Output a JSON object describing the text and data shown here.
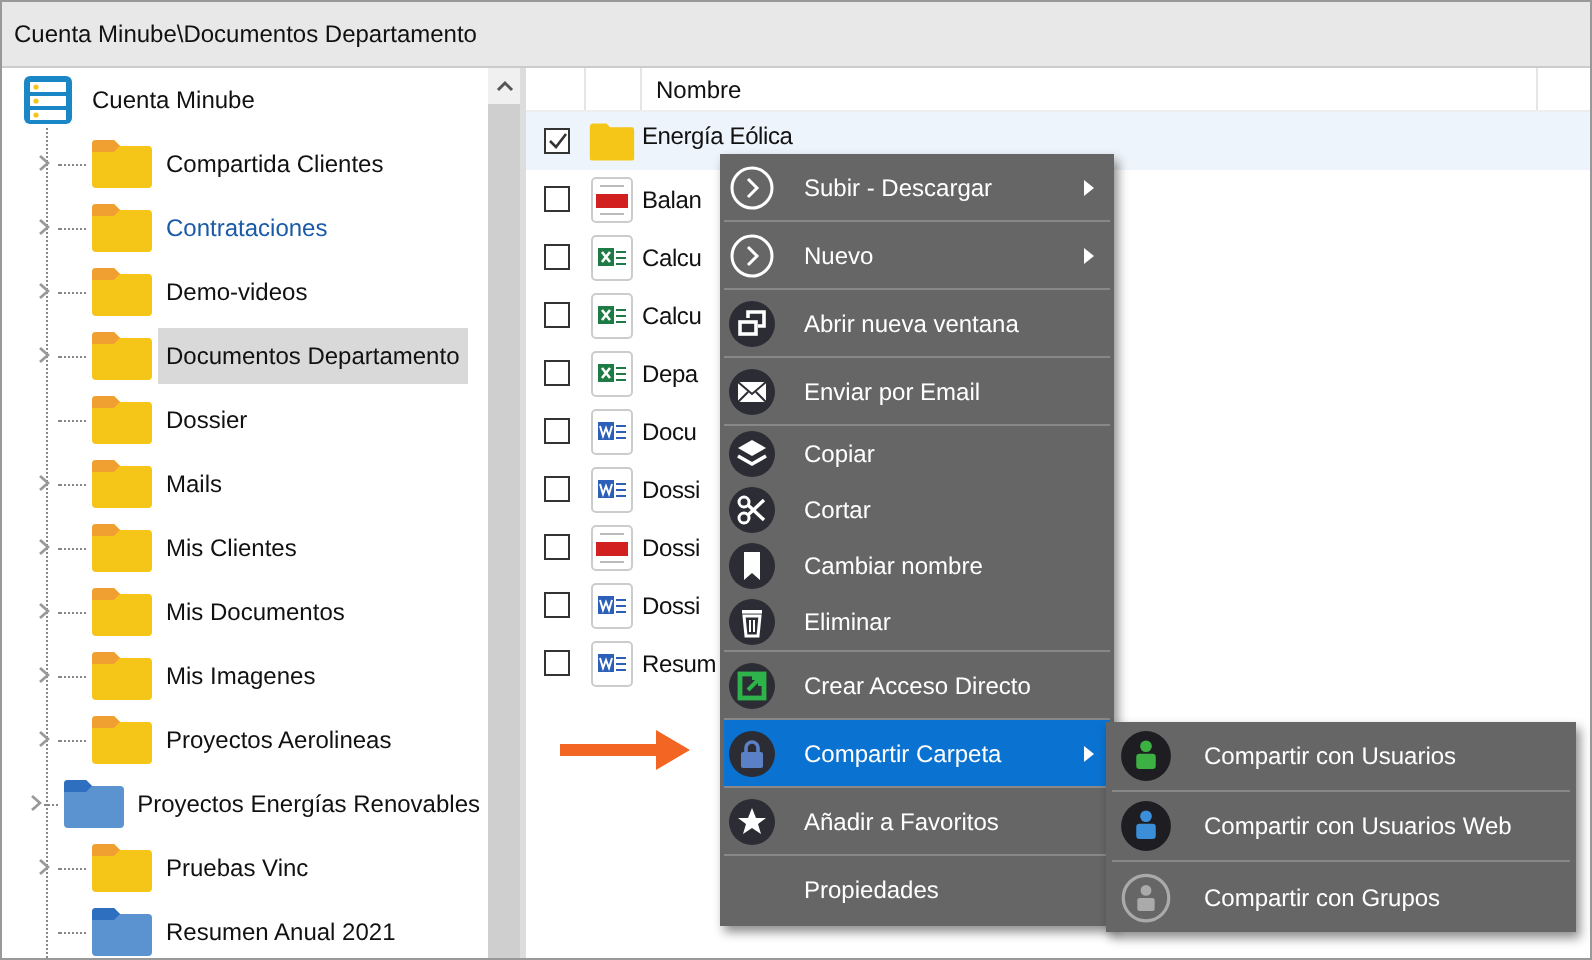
{
  "window": {
    "title": "Cuenta Minube\\Documentos Departamento"
  },
  "tree": {
    "root": {
      "label": "Cuenta Minube"
    },
    "children": [
      {
        "label": "Compartida Clientes",
        "color": "#f5c518",
        "expandable": true,
        "selected": false,
        "hovered": false
      },
      {
        "label": "Contrataciones",
        "color": "#f5c518",
        "expandable": true,
        "selected": false,
        "hovered": true
      },
      {
        "label": "Demo-videos",
        "color": "#f5c518",
        "expandable": true,
        "selected": false,
        "hovered": false
      },
      {
        "label": "Documentos Departamento",
        "color": "#f5c518",
        "expandable": true,
        "selected": true,
        "hovered": false
      },
      {
        "label": "Dossier",
        "color": "#f5c518",
        "expandable": false,
        "selected": false,
        "hovered": false
      },
      {
        "label": "Mails",
        "color": "#f5c518",
        "expandable": true,
        "selected": false,
        "hovered": false
      },
      {
        "label": "Mis Clientes",
        "color": "#f5c518",
        "expandable": true,
        "selected": false,
        "hovered": false
      },
      {
        "label": "Mis Documentos",
        "color": "#f5c518",
        "expandable": true,
        "selected": false,
        "hovered": false
      },
      {
        "label": "Mis Imagenes",
        "color": "#f5c518",
        "expandable": true,
        "selected": false,
        "hovered": false
      },
      {
        "label": "Proyectos Aerolineas",
        "color": "#f5c518",
        "expandable": true,
        "selected": false,
        "hovered": false
      },
      {
        "label": "Proyectos Energías Renovables",
        "color": "#5b92d0",
        "expandable": true,
        "selected": false,
        "hovered": false
      },
      {
        "label": "Pruebas Vinc",
        "color": "#f5c518",
        "expandable": true,
        "selected": false,
        "hovered": false
      },
      {
        "label": "Resumen Anual 2021",
        "color": "#5b92d0",
        "expandable": false,
        "selected": false,
        "hovered": false
      }
    ]
  },
  "table": {
    "columns": [
      "Nombre"
    ],
    "rows": [
      {
        "kind": "folder",
        "name": "Energía Eólica",
        "checked": true,
        "selected": true
      },
      {
        "kind": "pdf",
        "name": "Balan",
        "checked": false,
        "selected": false
      },
      {
        "kind": "excel",
        "name": "Calcu",
        "checked": false,
        "selected": false
      },
      {
        "kind": "excel",
        "name": "Calcu",
        "checked": false,
        "selected": false
      },
      {
        "kind": "excel",
        "name": "Depa",
        "checked": false,
        "selected": false
      },
      {
        "kind": "word",
        "name": "Docu",
        "checked": false,
        "selected": false
      },
      {
        "kind": "word",
        "name": "Dossi",
        "checked": false,
        "selected": false
      },
      {
        "kind": "pdf",
        "name": "Dossi",
        "checked": false,
        "selected": false
      },
      {
        "kind": "word",
        "name": "Dossi",
        "checked": false,
        "selected": false
      },
      {
        "kind": "word",
        "name": "Resum",
        "checked": false,
        "selected": false
      }
    ]
  },
  "context_menu": {
    "groups": [
      [
        {
          "kind": "chevron",
          "label": "Subir - Descargar",
          "submenu": true,
          "selected": false
        }
      ],
      [
        {
          "kind": "chevron",
          "label": "Nuevo",
          "submenu": true,
          "selected": false
        }
      ],
      [
        {
          "kind": "window",
          "label": "Abrir nueva ventana",
          "submenu": false,
          "selected": false
        }
      ],
      [
        {
          "kind": "mail",
          "label": "Enviar por Email",
          "submenu": false,
          "selected": false
        }
      ],
      [
        {
          "kind": "layers",
          "label": "Copiar",
          "submenu": false,
          "selected": false
        },
        {
          "kind": "scissors",
          "label": "Cortar",
          "submenu": false,
          "selected": false
        },
        {
          "kind": "bookmark",
          "label": "Cambiar nombre",
          "submenu": false,
          "selected": false
        },
        {
          "kind": "trash",
          "label": "Eliminar",
          "submenu": false,
          "selected": false
        }
      ],
      [
        {
          "kind": "shortcut",
          "label": "Crear Acceso Directo",
          "submenu": false,
          "selected": false
        }
      ],
      [
        {
          "kind": "lock",
          "label": "Compartir Carpeta",
          "submenu": true,
          "selected": true
        }
      ],
      [
        {
          "kind": "star",
          "label": "Añadir a Favoritos",
          "submenu": false,
          "selected": false
        }
      ],
      [
        {
          "kind": "none",
          "label": "Propiedades",
          "submenu": false,
          "selected": false
        }
      ]
    ]
  },
  "submenu": {
    "items": [
      {
        "kind": "user",
        "label": "Compartir con Usuarios",
        "color": "#3cb043"
      },
      {
        "kind": "user",
        "label": "Compartir con Usuarios Web",
        "color": "#3a8fd8"
      },
      {
        "kind": "group",
        "label": "Compartir con Grupos",
        "color": "#aaaaaa"
      }
    ]
  }
}
